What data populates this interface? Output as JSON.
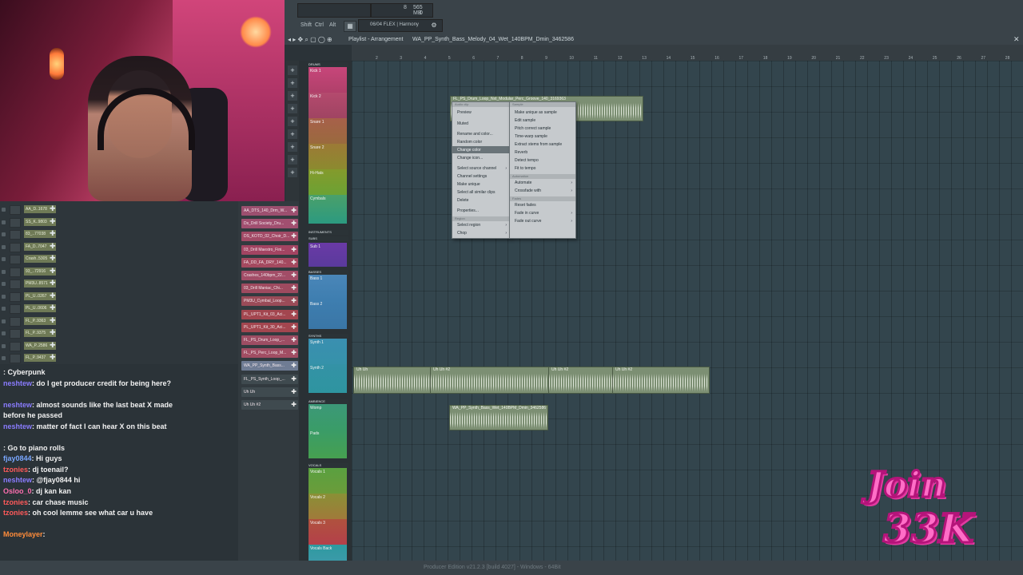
{
  "toolbar": {
    "cpu_label": "565 MB",
    "cpu_val": "8",
    "cpu_val2": "0",
    "shift": "Shift",
    "ctrl": "Ctrl",
    "alt": "Alt",
    "preset": "06/04  FLEX | Harmony"
  },
  "playlist": {
    "breadcrumb": "Playlist - Arrangement",
    "pattern": "WA_PP_Synth_Bass_Melody_04_Wet_140BPM_Dmin_3462586",
    "ruler": [
      "2",
      "3",
      "4",
      "5",
      "6",
      "7",
      "8",
      "9",
      "10",
      "11",
      "12",
      "13",
      "14",
      "15",
      "16",
      "17",
      "18",
      "19",
      "20",
      "21",
      "22",
      "23",
      "24",
      "25",
      "26",
      "27",
      "28"
    ]
  },
  "channels": [
    "AA_D..1678",
    "SS_K..9803",
    "83_..77038",
    "FA_D..7047",
    "Crash..5305",
    "93_..72916",
    "PM3U..8571",
    "PL_U..0267",
    "PL_U..0606",
    "FL_P..9363",
    "FL_P..9375",
    "WA_P..2586",
    "FL_P..9437"
  ],
  "browser": [
    {
      "label": "AA_DTS_140_Drm_W...",
      "color": "#9c4f6f"
    },
    {
      "label": "Ds_Drill Society_Dru...",
      "color": "#a14f70"
    },
    {
      "label": "DS_KOTD_02_Choir_D...",
      "color": "#a24a66"
    },
    {
      "label": "03_Drill Maestro_Fini...",
      "color": "#a34462"
    },
    {
      "label": "FA_DD_FA_DRY_140...",
      "color": "#a4495f"
    },
    {
      "label": "Crashes_140bpm_22...",
      "color": "#a24d67"
    },
    {
      "label": "03_Drill Maniac_Chi...",
      "color": "#9e4a5f"
    },
    {
      "label": "PM3U_Cymbal_Loop...",
      "color": "#9a4b58"
    },
    {
      "label": "PL_UPT1_Kit_03_Aci...",
      "color": "#a3464f"
    },
    {
      "label": "PL_UPT1_Kit_30_Aci...",
      "color": "#a3464f"
    },
    {
      "label": "FL_PS_Drum_Loop_...",
      "color": "#9d4d63"
    },
    {
      "label": "FL_PS_Perc_Loop_M...",
      "color": "#a14d63"
    },
    {
      "label": "WA_PP_Synth_Bass...",
      "color": "#6f7c94"
    },
    {
      "label": "FL_PS_Synth_Loop_...",
      "color": "#3f4a4f"
    },
    {
      "label": "Uh Uh",
      "color": "#3f4a4f"
    },
    {
      "label": "Uh Uh #2",
      "color": "#3f4a4f"
    }
  ],
  "groups": {
    "drums": "DRUMS",
    "instruments": "INSTRUMENTS",
    "subs": "SUBS",
    "basses": "BASSES",
    "synths": "SYNTHS",
    "ambience": "AMBIENCE",
    "vocals": "VOCALS"
  },
  "tracks": {
    "kick1": "Kick 1",
    "kick2": "Kick 2",
    "snare1": "Snare 1",
    "snare2": "Snare 2",
    "hihats": "Hi-Hats",
    "cymbals": "Cymbals",
    "sub1": "Sub 1",
    "bass1": "Bass 1",
    "bass2": "Bass 2",
    "synth1": "Synth 1",
    "synth2": "Synth 2",
    "womp": "Womp",
    "pads": "Pads",
    "vocals1": "Vocals 1",
    "vocals2": "Vocals 2",
    "vocals3": "Vocals 3",
    "vocalsback": "Vocals Back"
  },
  "clips": {
    "drum_loop": "FL_PS_Drum_Loop_Nxt_Modular_Perc_Groove_140_3169363",
    "uh_uh_a": "Uh Uh",
    "uh_uh_b": "Uh Uh #2",
    "uh_uh_c": "Uh Uh #2",
    "uh_uh_d": "Uh Uh #2",
    "synth_bass": "WA_PP_Synth_Bass_Wet_140BPM_Dmin_3462586"
  },
  "context_menu": {
    "col1_header": "Audio clip",
    "col1": [
      "Preview",
      "Muted",
      "Rename and color...",
      "Random color",
      "Change color",
      "Change icon...",
      "Select source channel",
      "Channel settings",
      "Make unique",
      "Select all similar clips",
      "Delete",
      "Properties..."
    ],
    "region_header": "Region",
    "region": [
      "Select region",
      "Chop"
    ],
    "col2_header": "Sample",
    "col2": [
      "Make unique as sample",
      "Edit sample",
      "Pitch correct sample",
      "Time-warp sample",
      "Extract stems from sample",
      "Reverb",
      "Detect tempo",
      "Fit to tempo"
    ],
    "automation_header": "Automation",
    "automation": [
      "Automate",
      "Crossfade with"
    ],
    "fades_header": "Fades",
    "fades": [
      "Reset fades",
      "Fade in curve",
      "Fade out curve"
    ]
  },
  "chat": [
    {
      "user": "",
      "text": ": Cyberpunk",
      "color": "#4caf50"
    },
    {
      "user": "neshtew",
      "text": ": do I get producer credit for being here?",
      "color": "#8a7cff"
    },
    {
      "user": "neshtew",
      "text": ": almost sounds like the last beat X made before he passed",
      "color": "#8a7cff"
    },
    {
      "user": "neshtew",
      "text": ": matter of fact I can hear X on this beat",
      "color": "#8a7cff"
    },
    {
      "user": "",
      "text": ": Go to piano rolls",
      "color": "#4caf50"
    },
    {
      "user": "fjay0844",
      "text": ": Hi guys",
      "color": "#7aa7ff"
    },
    {
      "user": "tzonies",
      "text": ": dj toenail?",
      "color": "#ff5a5a"
    },
    {
      "user": "neshtew",
      "text": ": @fjay0844 hi",
      "color": "#8a7cff"
    },
    {
      "user": "Osloo_0",
      "text": ": dj kan kan",
      "color": "#ff6fb0"
    },
    {
      "user": "tzonies",
      "text": ": car chase music",
      "color": "#ff5a5a"
    },
    {
      "user": "tzonies",
      "text": ": oh cool lemme see what car u have",
      "color": "#ff5a5a"
    },
    {
      "user": "Moneylayer",
      "text": ":",
      "color": "#ff8c3a"
    }
  ],
  "status": "Producer Edition v21.2.3 [build 4027] - Windows - 64Bit",
  "sticker": {
    "line1": "Join",
    "line2": "33K"
  }
}
